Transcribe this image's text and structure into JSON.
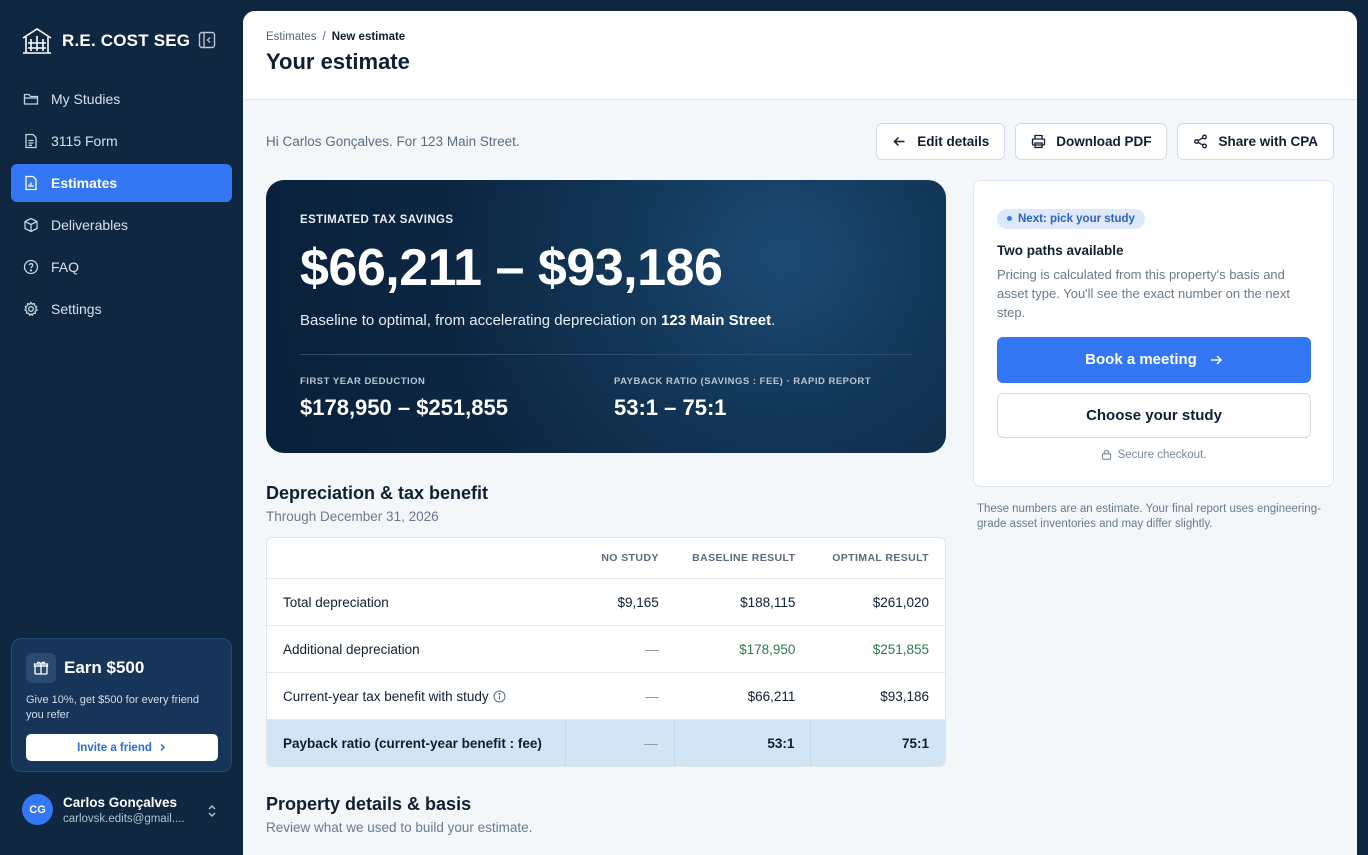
{
  "sidebar": {
    "brand": "R.E. COST SEG",
    "nav": [
      {
        "label": "My Studies",
        "icon": "folder-icon"
      },
      {
        "label": "3115 Form",
        "icon": "document-icon"
      },
      {
        "label": "Estimates",
        "icon": "chart-document-icon",
        "active": true
      },
      {
        "label": "Deliverables",
        "icon": "package-icon"
      },
      {
        "label": "FAQ",
        "icon": "help-circle-icon"
      },
      {
        "label": "Settings",
        "icon": "gear-icon"
      }
    ],
    "earn": {
      "title": "Earn $500",
      "description": "Give 10%, get $500 for every friend you refer",
      "invite_label": "Invite a friend"
    },
    "user": {
      "initials": "CG",
      "name": "Carlos Gonçalves",
      "email": "carlovsk.edits@gmail...."
    }
  },
  "header": {
    "breadcrumb": [
      "Estimates",
      "/",
      "New estimate"
    ],
    "title": "Your estimate"
  },
  "greeting": "Hi Carlos Gonçalves. For 123 Main Street.",
  "actions": {
    "edit": "Edit details",
    "download": "Download PDF",
    "share": "Share with CPA"
  },
  "hero": {
    "label": "ESTIMATED TAX SAVINGS",
    "value": "$66,211 – $93,186",
    "sub_prefix": "Baseline to optimal, from accelerating depreciation on ",
    "sub_address": "123 Main Street",
    "sub_suffix": ".",
    "stat1_label": "FIRST YEAR DEDUCTION",
    "stat1_value": "$178,950 – $251,855",
    "stat2_label": "PAYBACK RATIO (SAVINGS : FEE) · RAPID REPORT",
    "stat2_value": "53:1 – 75:1"
  },
  "side": {
    "pill": "Next: pick your study",
    "title": "Two paths available",
    "description": "Pricing is calculated from this property's basis and asset type. You'll see the exact number on the next step.",
    "book_label": "Book a meeting",
    "choose_label": "Choose your study",
    "secure_label": "Secure checkout.",
    "disclaimer": "These numbers are an estimate. Your final report uses engineering-grade asset inventories and may differ slightly."
  },
  "depreciation": {
    "title": "Depreciation & tax benefit",
    "subtitle": "Through December 31, 2026",
    "columns": [
      "",
      "NO STUDY",
      "BASELINE RESULT",
      "OPTIMAL RESULT"
    ],
    "rows": [
      {
        "label": "Total depreciation",
        "no_study": "$9,165",
        "baseline": "$188,115",
        "optimal": "$261,020"
      },
      {
        "label": "Additional depreciation",
        "no_study": "—",
        "baseline": "$178,950",
        "optimal": "$251,855"
      },
      {
        "label": "Current-year tax benefit with study",
        "no_study": "—",
        "baseline": "$66,211",
        "optimal": "$93,186"
      },
      {
        "label": "Payback ratio (current-year benefit : fee)",
        "no_study": "—",
        "baseline": "53:1",
        "optimal": "75:1"
      }
    ]
  },
  "property": {
    "title": "Property details & basis",
    "subtitle": "Review what we used to build your estimate."
  }
}
